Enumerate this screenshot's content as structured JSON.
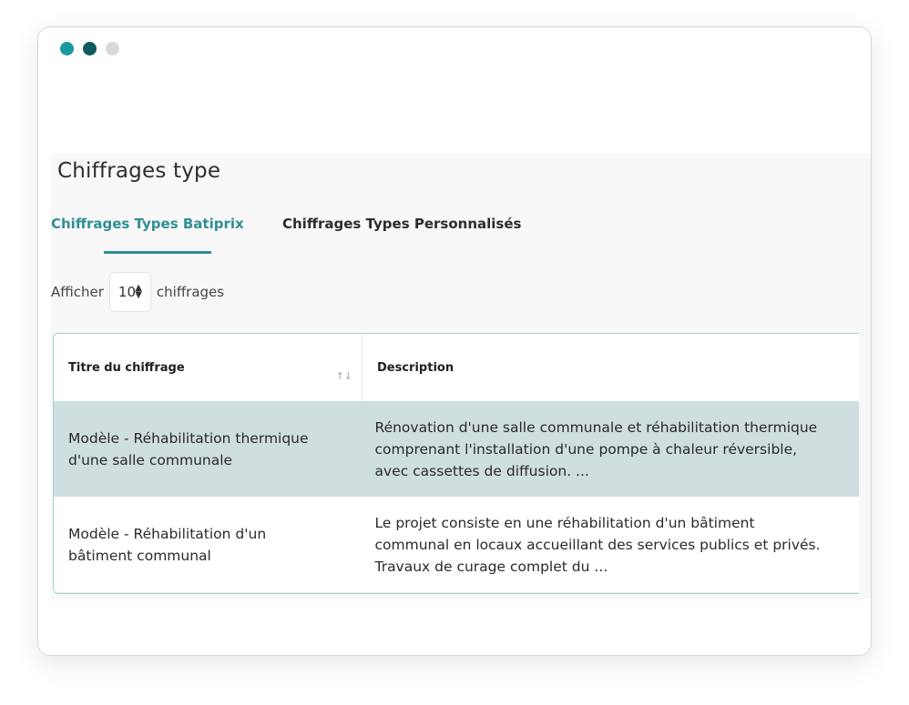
{
  "window": {
    "dots": [
      {
        "name": "dot-teal",
        "color": "#1a9aa0"
      },
      {
        "name": "dot-dark",
        "color": "#0d5b60"
      },
      {
        "name": "dot-grey",
        "color": "#d5d8dc"
      }
    ]
  },
  "page": {
    "title": "Chiffrages type"
  },
  "tabs": [
    {
      "label": "Chiffrages Types Batiprix",
      "active": true
    },
    {
      "label": "Chiffrages Types Personnalisés",
      "active": false
    }
  ],
  "length_control": {
    "prefix": "Afficher",
    "value": "10",
    "suffix": "chiffrages"
  },
  "table": {
    "headers": {
      "title": "Titre du chiffrage",
      "description": "Description"
    },
    "rows": [
      {
        "title_lines": [
          "Modèle - Réhabilitation thermique",
          "d'une salle communale"
        ],
        "description_lines": [
          "Rénovation d'une salle communale et réhabilitation thermique",
          "comprenant l'installation d'une pompe à chaleur réversible,",
          "avec cassettes de diffusion. ..."
        ],
        "highlighted": true
      },
      {
        "title_lines": [
          "Modèle - Réhabilitation d'un",
          "bâtiment communal"
        ],
        "description_lines": [
          "Le projet consiste en une réhabilitation d'un bâtiment",
          "communal en locaux accueillant des services publics et privés.",
          "Travaux de curage complet du ..."
        ],
        "highlighted": false
      }
    ]
  },
  "colors": {
    "accent": "#2f8f96",
    "row_highlight": "#cfdedf"
  }
}
